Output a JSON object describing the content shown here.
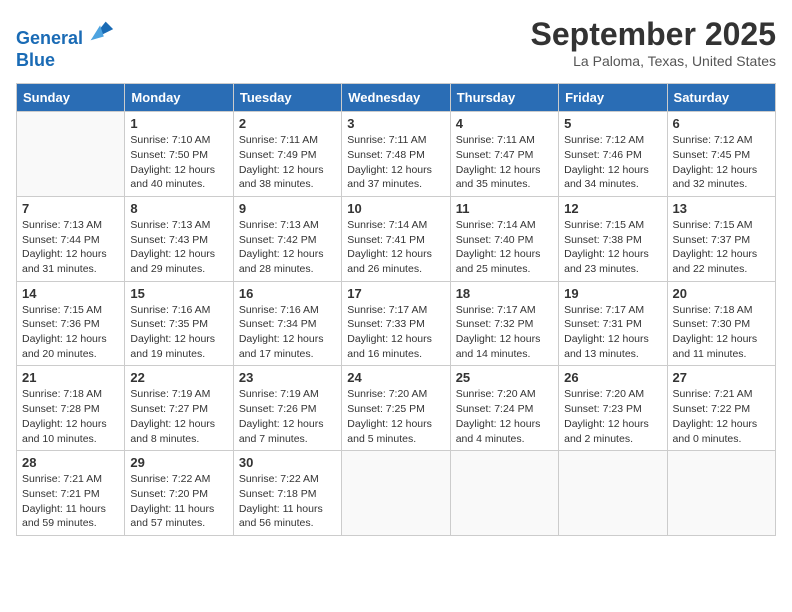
{
  "header": {
    "logo_line1": "General",
    "logo_line2": "Blue",
    "month_title": "September 2025",
    "location": "La Paloma, Texas, United States"
  },
  "weekdays": [
    "Sunday",
    "Monday",
    "Tuesday",
    "Wednesday",
    "Thursday",
    "Friday",
    "Saturday"
  ],
  "weeks": [
    [
      {
        "day": "",
        "info": ""
      },
      {
        "day": "1",
        "info": "Sunrise: 7:10 AM\nSunset: 7:50 PM\nDaylight: 12 hours\nand 40 minutes."
      },
      {
        "day": "2",
        "info": "Sunrise: 7:11 AM\nSunset: 7:49 PM\nDaylight: 12 hours\nand 38 minutes."
      },
      {
        "day": "3",
        "info": "Sunrise: 7:11 AM\nSunset: 7:48 PM\nDaylight: 12 hours\nand 37 minutes."
      },
      {
        "day": "4",
        "info": "Sunrise: 7:11 AM\nSunset: 7:47 PM\nDaylight: 12 hours\nand 35 minutes."
      },
      {
        "day": "5",
        "info": "Sunrise: 7:12 AM\nSunset: 7:46 PM\nDaylight: 12 hours\nand 34 minutes."
      },
      {
        "day": "6",
        "info": "Sunrise: 7:12 AM\nSunset: 7:45 PM\nDaylight: 12 hours\nand 32 minutes."
      }
    ],
    [
      {
        "day": "7",
        "info": "Sunrise: 7:13 AM\nSunset: 7:44 PM\nDaylight: 12 hours\nand 31 minutes."
      },
      {
        "day": "8",
        "info": "Sunrise: 7:13 AM\nSunset: 7:43 PM\nDaylight: 12 hours\nand 29 minutes."
      },
      {
        "day": "9",
        "info": "Sunrise: 7:13 AM\nSunset: 7:42 PM\nDaylight: 12 hours\nand 28 minutes."
      },
      {
        "day": "10",
        "info": "Sunrise: 7:14 AM\nSunset: 7:41 PM\nDaylight: 12 hours\nand 26 minutes."
      },
      {
        "day": "11",
        "info": "Sunrise: 7:14 AM\nSunset: 7:40 PM\nDaylight: 12 hours\nand 25 minutes."
      },
      {
        "day": "12",
        "info": "Sunrise: 7:15 AM\nSunset: 7:38 PM\nDaylight: 12 hours\nand 23 minutes."
      },
      {
        "day": "13",
        "info": "Sunrise: 7:15 AM\nSunset: 7:37 PM\nDaylight: 12 hours\nand 22 minutes."
      }
    ],
    [
      {
        "day": "14",
        "info": "Sunrise: 7:15 AM\nSunset: 7:36 PM\nDaylight: 12 hours\nand 20 minutes."
      },
      {
        "day": "15",
        "info": "Sunrise: 7:16 AM\nSunset: 7:35 PM\nDaylight: 12 hours\nand 19 minutes."
      },
      {
        "day": "16",
        "info": "Sunrise: 7:16 AM\nSunset: 7:34 PM\nDaylight: 12 hours\nand 17 minutes."
      },
      {
        "day": "17",
        "info": "Sunrise: 7:17 AM\nSunset: 7:33 PM\nDaylight: 12 hours\nand 16 minutes."
      },
      {
        "day": "18",
        "info": "Sunrise: 7:17 AM\nSunset: 7:32 PM\nDaylight: 12 hours\nand 14 minutes."
      },
      {
        "day": "19",
        "info": "Sunrise: 7:17 AM\nSunset: 7:31 PM\nDaylight: 12 hours\nand 13 minutes."
      },
      {
        "day": "20",
        "info": "Sunrise: 7:18 AM\nSunset: 7:30 PM\nDaylight: 12 hours\nand 11 minutes."
      }
    ],
    [
      {
        "day": "21",
        "info": "Sunrise: 7:18 AM\nSunset: 7:28 PM\nDaylight: 12 hours\nand 10 minutes."
      },
      {
        "day": "22",
        "info": "Sunrise: 7:19 AM\nSunset: 7:27 PM\nDaylight: 12 hours\nand 8 minutes."
      },
      {
        "day": "23",
        "info": "Sunrise: 7:19 AM\nSunset: 7:26 PM\nDaylight: 12 hours\nand 7 minutes."
      },
      {
        "day": "24",
        "info": "Sunrise: 7:20 AM\nSunset: 7:25 PM\nDaylight: 12 hours\nand 5 minutes."
      },
      {
        "day": "25",
        "info": "Sunrise: 7:20 AM\nSunset: 7:24 PM\nDaylight: 12 hours\nand 4 minutes."
      },
      {
        "day": "26",
        "info": "Sunrise: 7:20 AM\nSunset: 7:23 PM\nDaylight: 12 hours\nand 2 minutes."
      },
      {
        "day": "27",
        "info": "Sunrise: 7:21 AM\nSunset: 7:22 PM\nDaylight: 12 hours\nand 0 minutes."
      }
    ],
    [
      {
        "day": "28",
        "info": "Sunrise: 7:21 AM\nSunset: 7:21 PM\nDaylight: 11 hours\nand 59 minutes."
      },
      {
        "day": "29",
        "info": "Sunrise: 7:22 AM\nSunset: 7:20 PM\nDaylight: 11 hours\nand 57 minutes."
      },
      {
        "day": "30",
        "info": "Sunrise: 7:22 AM\nSunset: 7:18 PM\nDaylight: 11 hours\nand 56 minutes."
      },
      {
        "day": "",
        "info": ""
      },
      {
        "day": "",
        "info": ""
      },
      {
        "day": "",
        "info": ""
      },
      {
        "day": "",
        "info": ""
      }
    ]
  ]
}
